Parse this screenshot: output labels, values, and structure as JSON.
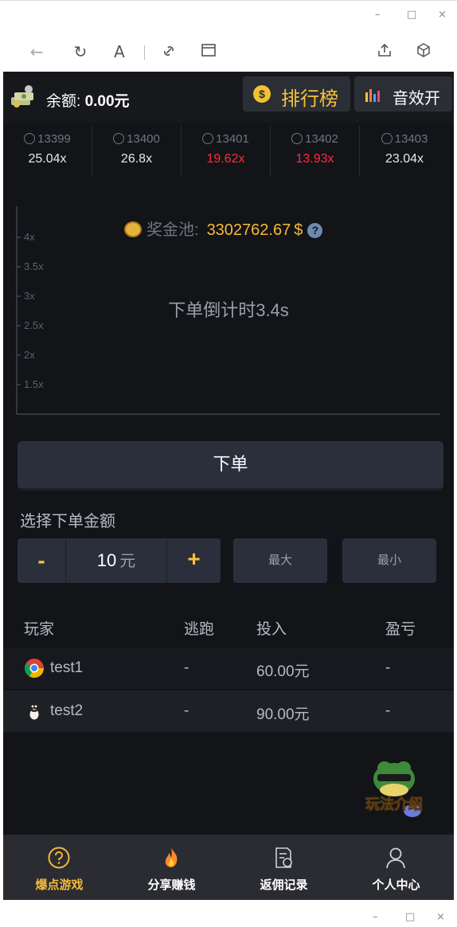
{
  "window": {
    "minimize": "–",
    "maximize": "□",
    "close": "×"
  },
  "toolbar": {
    "back_icon": "←",
    "refresh_icon": "↻",
    "text_icon": "A",
    "link_icon": "link",
    "tab_icon": "window",
    "share_icon": "share",
    "cube_icon": "cube"
  },
  "header": {
    "balance_label": "余额:",
    "balance_value": "0.00元",
    "rank_icon": "$",
    "rank_label": "排行榜",
    "sound_label": "音效开"
  },
  "history": [
    {
      "round": "13399",
      "multiplier": "25.04x",
      "color": "#e8e8e8"
    },
    {
      "round": "13400",
      "multiplier": "26.8x",
      "color": "#e8e8e8"
    },
    {
      "round": "13401",
      "multiplier": "19.62x",
      "color": "#ff2a3d"
    },
    {
      "round": "13402",
      "multiplier": "13.93x",
      "color": "#ff2a3d"
    },
    {
      "round": "13403",
      "multiplier": "23.04x",
      "color": "#e8e8e8"
    }
  ],
  "chart": {
    "y_ticks": [
      "4x",
      "3.5x",
      "3x",
      "2.5x",
      "2x",
      "1.5x"
    ],
    "pool_label": "奖金池:",
    "pool_value": "3302762.67",
    "pool_currency": "$",
    "help_icon": "?",
    "countdown": "下单倒计时3.4s"
  },
  "order": {
    "button_label": "下单",
    "amount_title": "选择下单金额",
    "minus": "-",
    "amount_value": "10",
    "amount_unit": "元",
    "plus": "+",
    "max_label": "最大",
    "min_label": "最小"
  },
  "players": {
    "headers": [
      "玩家",
      "逃跑",
      "投入",
      "盈亏"
    ],
    "rows": [
      {
        "name": "test1",
        "escape": "-",
        "bet": "60.00元",
        "profit": "-"
      },
      {
        "name": "test2",
        "escape": "-",
        "bet": "90.00元",
        "profit": "-"
      }
    ]
  },
  "howto_label": "玩法介绍",
  "nav": [
    {
      "label": "爆点游戏",
      "active": true
    },
    {
      "label": "分享赚钱",
      "active": false
    },
    {
      "label": "返佣记录",
      "active": false
    },
    {
      "label": "个人中心",
      "active": false
    }
  ],
  "colors": {
    "accent": "#f5b93a",
    "background": "#121418",
    "panel": "#2a2f3b",
    "loss": "#ff2a3d"
  }
}
